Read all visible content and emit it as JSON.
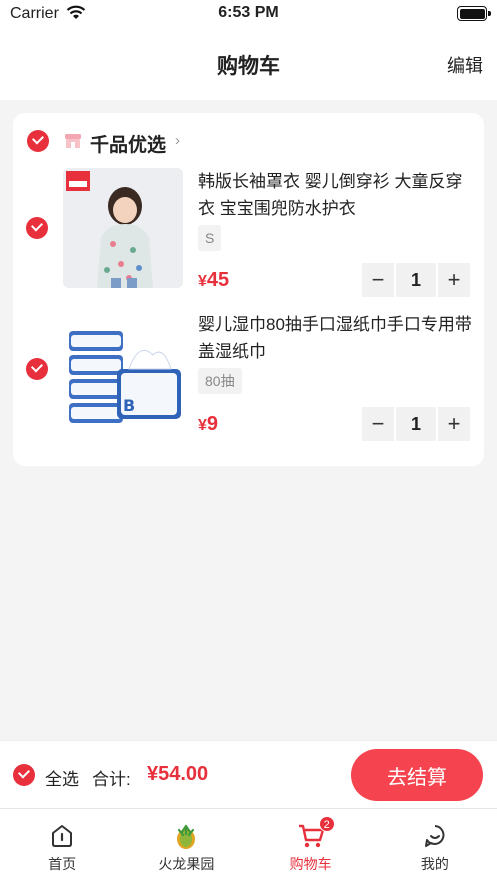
{
  "status": {
    "carrier": "Carrier",
    "time": "6:53 PM"
  },
  "header": {
    "title": "购物车",
    "edit_label": "编辑"
  },
  "store": {
    "name": "千品优选",
    "arrow": "›"
  },
  "items": [
    {
      "title": "韩版长袖罩衣 婴儿倒穿衫 大童反穿衣 宝宝围兜防水护衣",
      "spec": "S",
      "currency": "¥",
      "price": "45",
      "qty": "1"
    },
    {
      "title": "婴儿湿巾80抽手口湿纸巾手口专用带盖湿纸巾",
      "spec": "80抽",
      "currency": "¥",
      "price": "9",
      "qty": "1"
    }
  ],
  "stepper": {
    "minus": "−",
    "plus": "+"
  },
  "checkout": {
    "select_all_label": "全选",
    "total_label": "合计:",
    "total_value": "¥54.00",
    "button_label": "去结算"
  },
  "tabs": [
    {
      "label": "首页",
      "icon": "home-icon"
    },
    {
      "label": "火龙果园",
      "icon": "dragon-fruit-icon"
    },
    {
      "label": "购物车",
      "icon": "cart-icon",
      "badge": "2"
    },
    {
      "label": "我的",
      "icon": "profile-icon"
    }
  ],
  "colors": {
    "accent": "#e8303c",
    "button": "#f5444f",
    "background": "#f4f4f4"
  }
}
